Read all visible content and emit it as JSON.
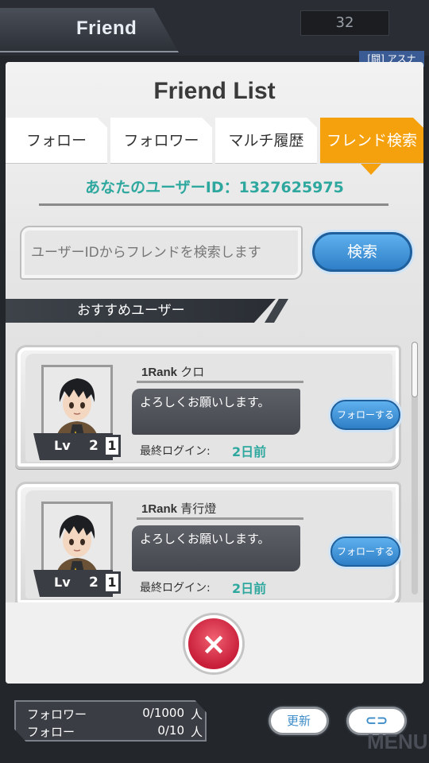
{
  "header": {
    "title": "Friend",
    "counter": "32",
    "badge": "[闘]  アスナ"
  },
  "dialog": {
    "title": "Friend List",
    "tabs": [
      {
        "label": "フォロー",
        "active": false
      },
      {
        "label": "フォロワー",
        "active": false
      },
      {
        "label": "マルチ履歴",
        "active": false
      },
      {
        "label": "フレンド検索",
        "active": true
      }
    ],
    "user_id": "あなたのユーザーID：1327625975",
    "search": {
      "placeholder": "ユーザーIDからフレンドを検索します",
      "button": "検索"
    },
    "section_title": "おすすめユーザー",
    "users": [
      {
        "rank": "1Rank",
        "name": "クロ",
        "comment": "よろしくお願いします。",
        "lv_label": "Lv",
        "lv": "2",
        "rarity": "1",
        "follow": "フォローする",
        "login_label": "最終ログイン:",
        "login_value": "2日前"
      },
      {
        "rank": "1Rank",
        "name": "青行燈",
        "comment": "よろしくお願いします。",
        "lv_label": "Lv",
        "lv": "2",
        "rarity": "1",
        "follow": "フォローする",
        "login_label": "最終ログイン:",
        "login_value": "2日前"
      }
    ],
    "close_icon": "×"
  },
  "footer": {
    "followers_label": "フォロワー",
    "followers_value": "0/1000",
    "followers_unit": "人",
    "following_label": "フォロー",
    "following_value": "0/10",
    "following_unit": "人",
    "refresh": "更新",
    "switch_icon": "⊂⊃",
    "menu": "MENU"
  },
  "colors": {
    "accent_orange": "#f5a10d",
    "teal": "#2ea89e",
    "button_blue": "#2e7fc6",
    "close_red": "#c81e3a"
  }
}
